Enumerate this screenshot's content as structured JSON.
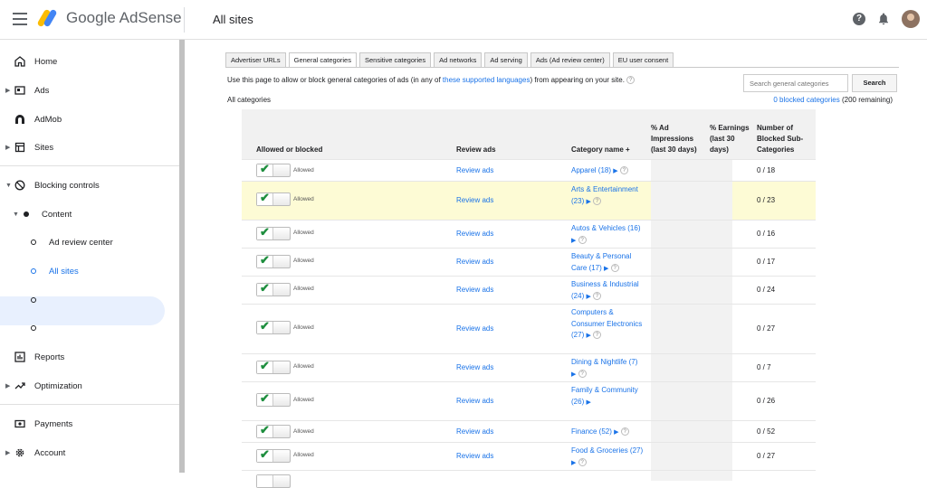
{
  "header": {
    "brand": "Google AdSense",
    "page_title": "All sites"
  },
  "sidebar": {
    "items": [
      {
        "label": "Home",
        "icon": "home-icon"
      },
      {
        "label": "Ads",
        "icon": "ads-icon"
      },
      {
        "label": "AdMob",
        "icon": "admob-icon"
      },
      {
        "label": "Sites",
        "icon": "sites-icon"
      },
      {
        "label": "Blocking controls",
        "icon": "block-icon"
      },
      {
        "label": "Content"
      },
      {
        "label": "Ad review center"
      },
      {
        "label": "All sites"
      },
      {
        "label": ""
      },
      {
        "label": ""
      },
      {
        "label": "Reports",
        "icon": "reports-icon"
      },
      {
        "label": "Optimization",
        "icon": "optimization-icon"
      },
      {
        "label": "Payments",
        "icon": "payments-icon"
      },
      {
        "label": "Account",
        "icon": "gear-icon"
      }
    ]
  },
  "tabs": [
    "Advertiser URLs",
    "General categories",
    "Sensitive categories",
    "Ad networks",
    "Ad serving",
    "Ads (Ad review center)",
    "EU user consent"
  ],
  "active_tab": "General categories",
  "description": {
    "prefix": "Use this page to allow or block general categories of ads (in any of ",
    "link": "these supported languages",
    "suffix": ") from appearing on your site."
  },
  "search": {
    "placeholder": "Search general categories",
    "button": "Search"
  },
  "all_categories_label": "All categories",
  "blocked_summary": {
    "link": "0 blocked categories",
    "remaining": "(200 remaining)"
  },
  "table": {
    "headers": {
      "allowed": "Allowed or blocked",
      "review": "Review ads",
      "category": "Category name",
      "impressions": "% Ad Impressions (last 30 days)",
      "earnings": "% Earnings (last 30 days)",
      "blocked_sub": "Number of Blocked Sub-Categories"
    },
    "rows": [
      {
        "status": "Allowed",
        "review": "Review ads",
        "category": "Apparel (18)",
        "blocked": "0 / 18"
      },
      {
        "status": "Allowed",
        "review": "Review ads",
        "category": "Arts & Entertainment (23)",
        "blocked": "0 / 23"
      },
      {
        "status": "Allowed",
        "review": "Review ads",
        "category": "Autos & Vehicles (16)",
        "blocked": "0 / 16"
      },
      {
        "status": "Allowed",
        "review": "Review ads",
        "category": "Beauty & Personal Care (17)",
        "blocked": "0 / 17"
      },
      {
        "status": "Allowed",
        "review": "Review ads",
        "category": "Business & Industrial (24)",
        "blocked": "0 / 24"
      },
      {
        "status": "Allowed",
        "review": "Review ads",
        "category": "Computers & Consumer Electronics (27)",
        "blocked": "0 / 27"
      },
      {
        "status": "Allowed",
        "review": "Review ads",
        "category": "Dining & Nightlife (7)",
        "blocked": "0 / 7"
      },
      {
        "status": "Allowed",
        "review": "Review ads",
        "category": "Family & Community (26)",
        "blocked": "0 / 26"
      },
      {
        "status": "Allowed",
        "review": "Review ads",
        "category": "Finance (52)",
        "blocked": "0 / 52"
      },
      {
        "status": "Allowed",
        "review": "Review ads",
        "category": "Food & Groceries (27)",
        "blocked": "0 / 27"
      }
    ]
  },
  "colors": {
    "link": "#1a73e8",
    "check": "#1e8e3e",
    "highlight_row": "#fdfbd5",
    "active_nav": "#e8f0fe"
  }
}
